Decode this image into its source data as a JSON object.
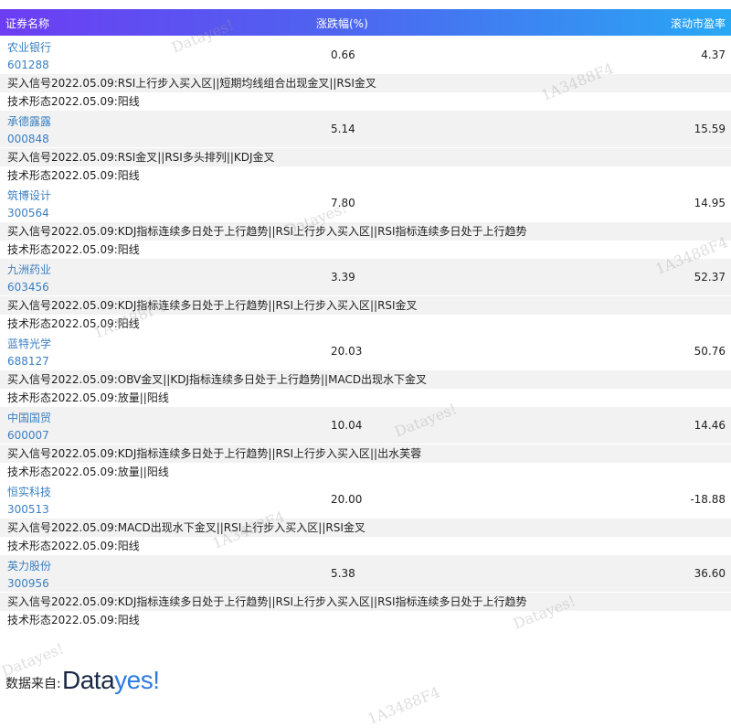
{
  "header": {
    "name_col": "证券名称",
    "change_col": "涨跌幅(%)",
    "pe_col": "滚动市盈率"
  },
  "stocks": [
    {
      "name": "农业银行",
      "code": "601288",
      "change": "0.66",
      "pe": "4.37",
      "signal": "买入信号2022.05.09:RSI上行步入买入区||短期均线组合出现金叉||RSI金叉",
      "form": "技术形态2022.05.09:阳线"
    },
    {
      "name": "承德露露",
      "code": "000848",
      "change": "5.14",
      "pe": "15.59",
      "signal": "买入信号2022.05.09:RSI金叉||RSI多头排列||KDJ金叉",
      "form": "技术形态2022.05.09:阳线"
    },
    {
      "name": "筑博设计",
      "code": "300564",
      "change": "7.80",
      "pe": "14.95",
      "signal": "买入信号2022.05.09:KDJ指标连续多日处于上行趋势||RSI上行步入买入区||RSI指标连续多日处于上行趋势",
      "form": "技术形态2022.05.09:阳线"
    },
    {
      "name": "九洲药业",
      "code": "603456",
      "change": "3.39",
      "pe": "52.37",
      "signal": "买入信号2022.05.09:KDJ指标连续多日处于上行趋势||RSI上行步入买入区||RSI金叉",
      "form": "技术形态2022.05.09:阳线"
    },
    {
      "name": "蓝特光学",
      "code": "688127",
      "change": "20.03",
      "pe": "50.76",
      "signal": "买入信号2022.05.09:OBV金叉||KDJ指标连续多日处于上行趋势||MACD出现水下金叉",
      "form": "技术形态2022.05.09:放量||阳线"
    },
    {
      "name": "中国国贸",
      "code": "600007",
      "change": "10.04",
      "pe": "14.46",
      "signal": "买入信号2022.05.09:KDJ指标连续多日处于上行趋势||RSI上行步入买入区||出水芙蓉",
      "form": "技术形态2022.05.09:放量||阳线"
    },
    {
      "name": "恒实科技",
      "code": "300513",
      "change": "20.00",
      "pe": "-18.88",
      "signal": "买入信号2022.05.09:MACD出现水下金叉||RSI上行步入买入区||RSI金叉",
      "form": "技术形态2022.05.09:阳线"
    },
    {
      "name": "英力股份",
      "code": "300956",
      "change": "5.38",
      "pe": "36.60",
      "signal": "买入信号2022.05.09:KDJ指标连续多日处于上行趋势||RSI上行步入买入区||RSI指标连续多日处于上行趋势",
      "form": "技术形态2022.05.09:阳线"
    }
  ],
  "watermarks": [
    "Datayes!",
    "1A3488F4",
    "Datayes!",
    "1A3488F4",
    "1A3488F4",
    "Datayes!",
    "1A3488F4",
    "Datayes!",
    "Datayes!",
    "1A3488F4"
  ],
  "footer": {
    "source_label": "数据来自:",
    "logo_part1": "Data",
    "logo_part2": "yes!",
    "logo_color_dark": "#1b2a44",
    "logo_color_blue": "#2e7be0"
  },
  "colors": {
    "header_gradient_start": "#6c3df2",
    "header_gradient_end": "#28a8f4",
    "link_blue": "#3a7fc2",
    "row_shade": "#f2f2f2"
  }
}
